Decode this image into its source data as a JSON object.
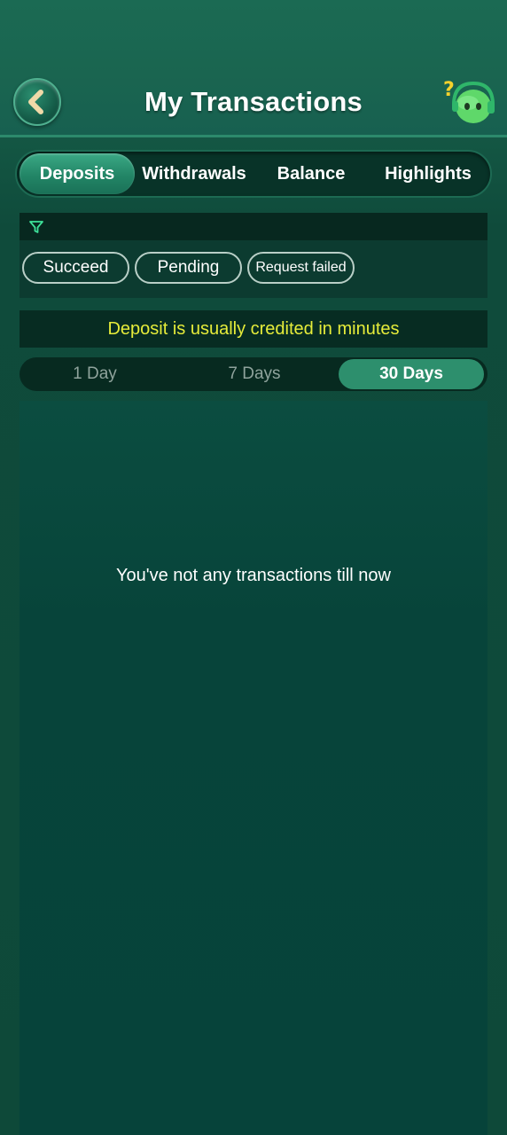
{
  "header": {
    "title": "My Transactions"
  },
  "tabs": [
    {
      "label": "Deposits",
      "active": true
    },
    {
      "label": "Withdrawals",
      "active": false
    },
    {
      "label": "Balance",
      "active": false
    },
    {
      "label": "Highlights",
      "active": false
    }
  ],
  "filter": {
    "icon": "filter-icon",
    "chips": [
      {
        "label": "Succeed"
      },
      {
        "label": "Pending"
      },
      {
        "label": "Request failed"
      }
    ]
  },
  "notice": "Deposit is usually credited in minutes",
  "period": {
    "options": [
      {
        "label": "1 Day",
        "active": false
      },
      {
        "label": "7 Days",
        "active": false
      },
      {
        "label": "30 Days",
        "active": true
      }
    ]
  },
  "content": {
    "empty_message": "You've not any transactions till now"
  },
  "colors": {
    "accent": "#2d8f6d",
    "notice_text": "#e6ec3a",
    "background": "#0e4939"
  }
}
